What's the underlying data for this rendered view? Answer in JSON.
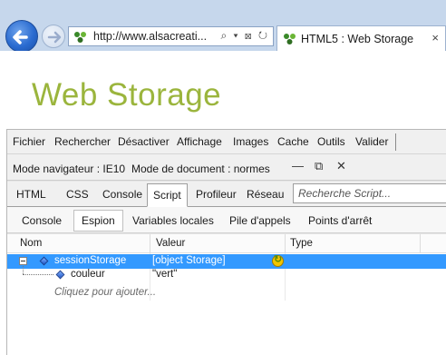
{
  "browser": {
    "url": "http://www.alsacreati...",
    "address_tools": "⌕ ▾ ⊠ ↻",
    "tab_title": "HTML5 : Web Storage",
    "tab_close": "×"
  },
  "page": {
    "heading": "Web Storage",
    "heading_color": "#9bb53d"
  },
  "devtools": {
    "menu": [
      "Fichier",
      "Rechercher",
      "Désactiver",
      "Affichage",
      "Images",
      "Cache",
      "Outils",
      "Valider"
    ],
    "mode": {
      "browser_mode": "Mode navigateur : IE10",
      "document_mode": "Mode de document : normes",
      "minimize": "—",
      "restore": "⧉",
      "close": "✕"
    },
    "tabs": [
      "HTML",
      "CSS",
      "Console",
      "Script",
      "Profileur",
      "Réseau"
    ],
    "active_tab": "Script",
    "search_placeholder": "Recherche Script...",
    "subtabs": [
      "Console",
      "Espion",
      "Variables locales",
      "Pile d'appels",
      "Points d'arrêt"
    ],
    "active_subtab": "Espion",
    "grid": {
      "columns": [
        "Nom",
        "Valeur",
        "Type"
      ],
      "rows": [
        {
          "name": "sessionStorage",
          "value": "[object Storage]",
          "type": "",
          "selected": true,
          "expanded": true
        },
        {
          "name": "couleur",
          "value": "\"vert\"",
          "type": "",
          "selected": false
        }
      ],
      "add_prompt": "Cliquez pour ajouter..."
    },
    "selection_color": "#3399ff"
  }
}
